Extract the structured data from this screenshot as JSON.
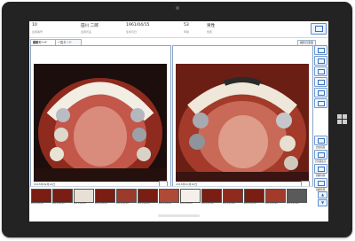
{
  "patient": {
    "id": "10",
    "id_label": "患者番号",
    "name": "田川 二郎",
    "name_label": "患者氏名",
    "birthdate": "1961/04/15",
    "birthdate_label": "生年月日",
    "age": "53",
    "age_label": "年齢",
    "gender": "男性",
    "gender_label": "性別"
  },
  "tabs": [
    {
      "label": "顔貌モード"
    },
    {
      "label": "一覧モード"
    }
  ],
  "right_tab": "撮影日変更",
  "left_pane": {
    "caption": "2015年09月10日"
  },
  "right_pane": {
    "caption": "2015年10月20日"
  },
  "side_buttons": [
    {
      "label": ""
    },
    {
      "label": ""
    },
    {
      "label": ""
    },
    {
      "label": ""
    },
    {
      "label": ""
    },
    {
      "label": ""
    },
    {
      "label": "比較画面"
    },
    {
      "label": "全画面表示"
    },
    {
      "label": "画像印刷"
    },
    {
      "label": "画像管理"
    }
  ],
  "thumbnails": [
    {
      "date": "2015/09/10"
    },
    {
      "date": "2015/09/10"
    },
    {
      "date": "2015/09/10"
    },
    {
      "date": "2015/09/10"
    },
    {
      "date": "2015/09/10"
    },
    {
      "date": "2015/09/10"
    },
    {
      "date": "2015/09/10"
    },
    {
      "date": "2015/09/10"
    },
    {
      "date": "2015/10/20"
    },
    {
      "date": "2015/10/20"
    },
    {
      "date": "2015/10/20"
    },
    {
      "date": "2015/10/20"
    },
    {
      "date": "2015/10/20"
    }
  ],
  "colors": {
    "accent": "#3a6fbf",
    "tablet": "#232323"
  }
}
